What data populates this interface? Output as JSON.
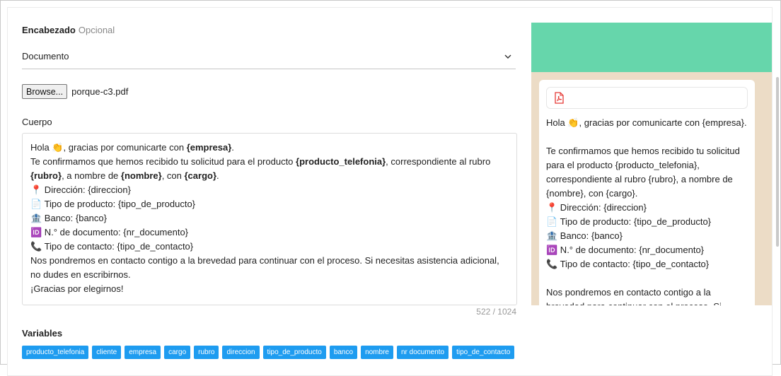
{
  "header": {
    "label": "Encabezado",
    "optional": "Opcional"
  },
  "header_select": {
    "value": "Documento",
    "icon": "chevron-down-icon"
  },
  "file": {
    "button": "Browse...",
    "filename": "porque-c3.pdf"
  },
  "body": {
    "label": "Cuerpo",
    "counter": "522 / 1024",
    "lines": [
      [
        {
          "t": "Hola "
        },
        {
          "e": "👏"
        },
        {
          "t": ", gracias por comunicarte con "
        },
        {
          "b": "{empresa}"
        },
        {
          "t": "."
        }
      ],
      [
        {
          "t": "Te confirmamos que hemos recibido tu solicitud para el producto "
        },
        {
          "b": "{producto_telefonia}"
        },
        {
          "t": ", correspondiente al rubro"
        }
      ],
      [
        {
          "b": "{rubro}"
        },
        {
          "t": ", a nombre de "
        },
        {
          "b": "{nombre}"
        },
        {
          "t": ", con "
        },
        {
          "b": "{cargo}"
        },
        {
          "t": "."
        }
      ],
      [
        {
          "e": "📍"
        },
        {
          "t": " Dirección: {direccion}"
        }
      ],
      [
        {
          "e": "📄"
        },
        {
          "t": " Tipo de producto: {tipo_de_producto}"
        }
      ],
      [
        {
          "e": "🏦"
        },
        {
          "t": " Banco: {banco}"
        }
      ],
      [
        {
          "e": "🆔"
        },
        {
          "t": " N.° de documento: {nr_documento}"
        }
      ],
      [
        {
          "e": "📞"
        },
        {
          "t": " Tipo de contacto: {tipo_de_contacto}"
        }
      ],
      [
        {
          "t": "Nos pondremos en contacto contigo a la brevedad para continuar con el proceso. Si necesitas asistencia adicional,"
        }
      ],
      [
        {
          "t": "no dudes en escribirnos."
        }
      ],
      [
        {
          "t": "¡Gracias por elegirnos!"
        }
      ]
    ]
  },
  "variables": {
    "label": "Variables",
    "items": [
      "producto_telefonia",
      "cliente",
      "empresa",
      "cargo",
      "rubro",
      "direccion",
      "tipo_de_producto",
      "banco",
      "nombre",
      "nr documento",
      "tipo_de_contacto"
    ]
  },
  "preview": {
    "attachment_icon": "pdf-icon",
    "lines": [
      [
        {
          "t": "Hola "
        },
        {
          "e": "👏"
        },
        {
          "t": ", gracias por comunicarte con {empresa}."
        }
      ],
      [],
      [
        {
          "t": "Te confirmamos que hemos recibido tu solicitud"
        }
      ],
      [
        {
          "t": "para el producto {producto_telefonia},"
        }
      ],
      [
        {
          "t": "correspondiente al rubro {rubro}, a nombre de"
        }
      ],
      [
        {
          "t": "{nombre}, con {cargo}."
        }
      ],
      [
        {
          "e": "📍"
        },
        {
          "t": " Dirección: {direccion}"
        }
      ],
      [
        {
          "e": "📄"
        },
        {
          "t": " Tipo de producto: {tipo_de_producto}"
        }
      ],
      [
        {
          "e": "🏦"
        },
        {
          "t": " Banco: {banco}"
        }
      ],
      [
        {
          "e": "🆔"
        },
        {
          "t": " N.° de documento: {nr_documento}"
        }
      ],
      [
        {
          "e": "📞"
        },
        {
          "t": " Tipo de contacto: {tipo_de_contacto}"
        }
      ],
      [],
      [
        {
          "t": "Nos pondremos en contacto contigo a la"
        }
      ],
      [
        {
          "t": "brevedad para continuar con el proceso. Si"
        }
      ]
    ]
  },
  "colors": {
    "accent": "#1e9cf0",
    "preview_header": "#66d6ab",
    "preview_bg": "#ecdcc6",
    "pdf_red": "#e53935"
  }
}
